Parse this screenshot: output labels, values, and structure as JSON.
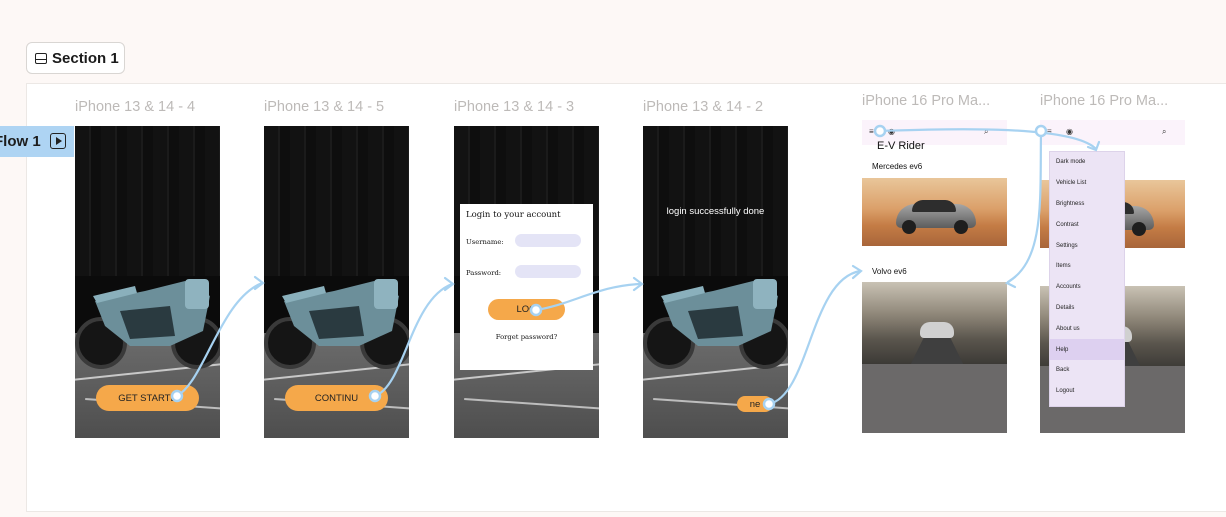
{
  "section": {
    "label": "Section 1"
  },
  "flow": {
    "label": "Flow 1"
  },
  "frames": [
    {
      "label": "iPhone 13 & 14 - 4"
    },
    {
      "label": "iPhone 13 & 14 - 5"
    },
    {
      "label": "iPhone 13 & 14 - 3"
    },
    {
      "label": "iPhone 13 & 14 - 2"
    },
    {
      "label": "iPhone 16 Pro Ma..."
    },
    {
      "label": "iPhone 16 Pro Ma..."
    }
  ],
  "screen1": {
    "button": "GET STARTE"
  },
  "screen2": {
    "button": "CONTINU"
  },
  "screen3": {
    "title": "Login to your account",
    "username_label": "Username:",
    "password_label": "Password:",
    "button": "LOG",
    "forget": "Forget password?"
  },
  "screen4": {
    "message": "login successfully done",
    "button": "ne"
  },
  "screen5": {
    "title": "E-V Rider",
    "car1": "Mercedes ev6",
    "car2": "Volvo ev6"
  },
  "menu": {
    "items": [
      "Dark mode",
      "Vehicle List",
      "Brightness",
      "Contrast",
      "Settings",
      "Items",
      "Accounts",
      "Details",
      "About us",
      "Help",
      "Back",
      "Logout"
    ],
    "active": "Help"
  },
  "colors": {
    "accent": "#f5a84a",
    "flow_line": "#a7d2f1",
    "flow_tab": "#aed4f3"
  }
}
